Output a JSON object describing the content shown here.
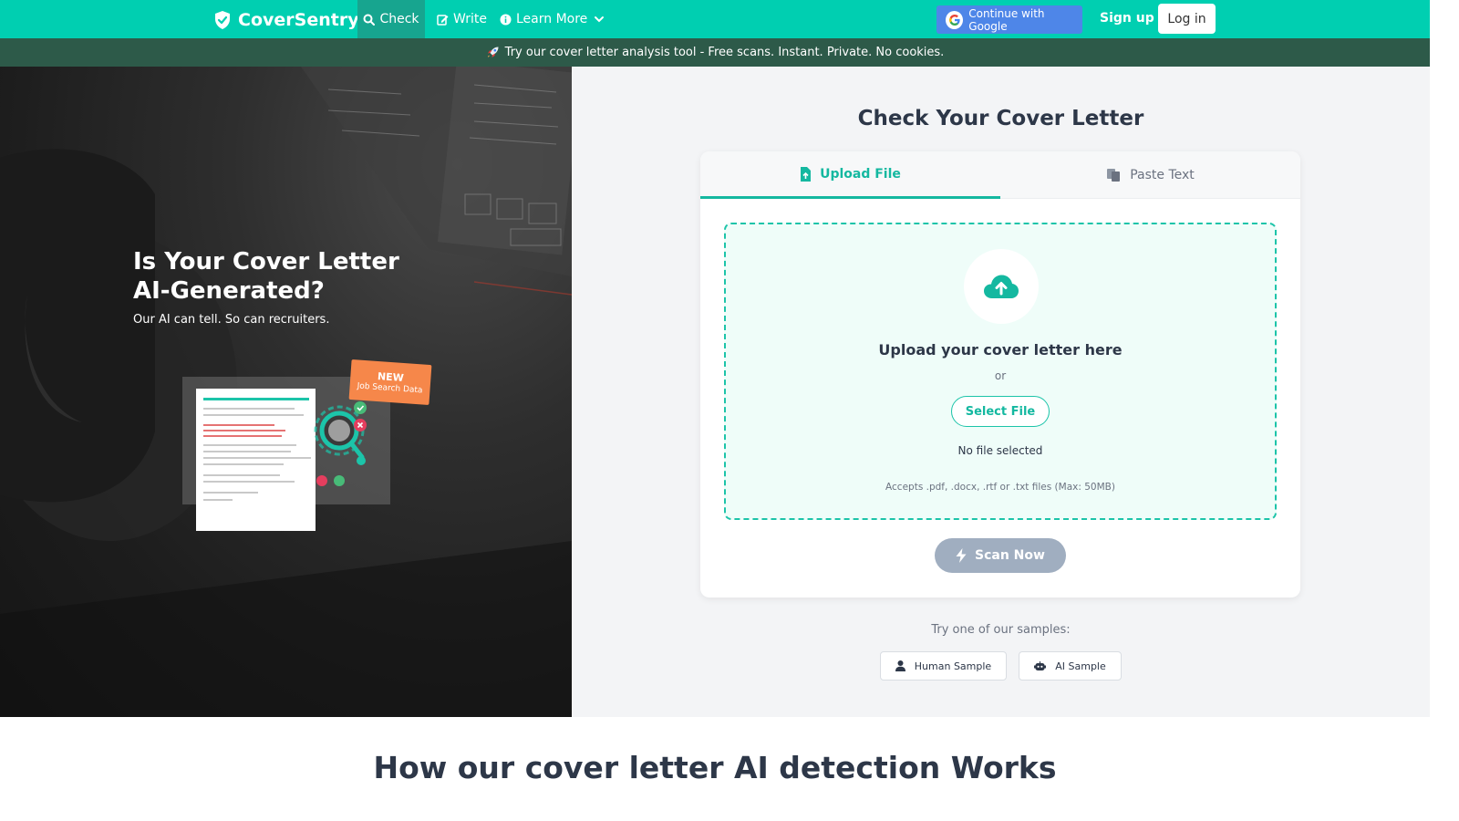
{
  "nav": {
    "brand": "CoverSentry",
    "check": "Check",
    "write": "Write",
    "learn_more": "Learn More",
    "google": "Continue with Google",
    "signup": "Sign up",
    "login": "Log in"
  },
  "banner": {
    "icon": "rocket-icon",
    "text": "Try our cover letter analysis tool - Free scans. Instant. Private. No cookies."
  },
  "hero": {
    "title": "Is Your Cover Letter AI-Generated?",
    "subtitle": "Our AI can tell. So can recruiters.",
    "badge_new": "NEW",
    "badge_sub": "Job Search Data"
  },
  "checker": {
    "title": "Check Your Cover Letter",
    "tabs": [
      "Upload File",
      "Paste Text"
    ],
    "upload_title": "Upload your cover letter here",
    "or": "or",
    "select_file": "Select File",
    "no_file": "No file selected",
    "accepts": "Accepts .pdf, .docx, .rtf or .txt files (Max: 50MB)",
    "scan": "Scan Now",
    "samples_label": "Try one of our samples:",
    "samples": [
      "Human Sample",
      "AI Sample"
    ]
  },
  "how": {
    "title": "How our cover letter AI detection Works"
  },
  "colors": {
    "brand": "#00cfb1",
    "brand_dark": "#17a58f",
    "banner": "#2d5a49",
    "accent_text": "#14b8a0",
    "disabled": "#a0aec0"
  }
}
